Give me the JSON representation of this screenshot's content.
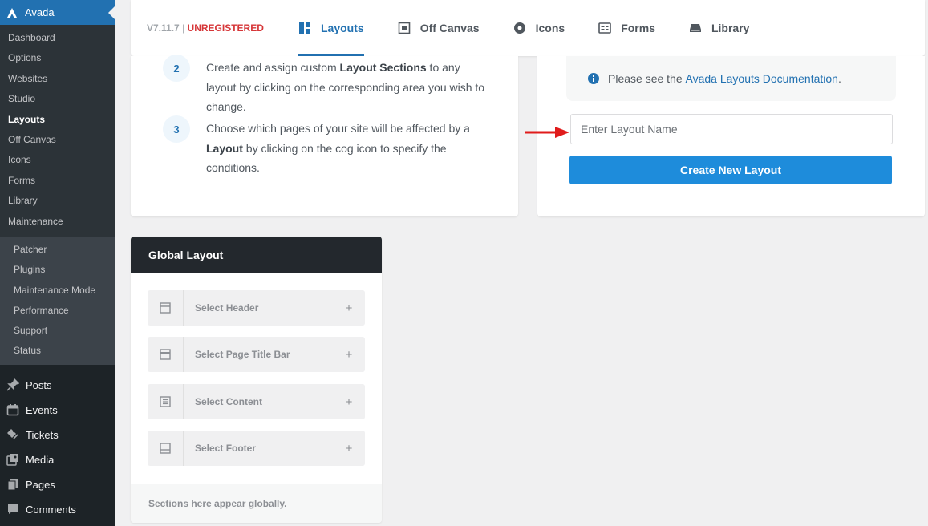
{
  "sidebar": {
    "brand": "Avada",
    "avada_submenu": [
      "Dashboard",
      "Options",
      "Websites",
      "Studio",
      "Layouts",
      "Off Canvas",
      "Icons",
      "Forms",
      "Library",
      "Maintenance"
    ],
    "maintenance_submenu": [
      "Patcher",
      "Plugins",
      "Maintenance Mode",
      "Performance",
      "Support",
      "Status"
    ],
    "main_menu": [
      {
        "label": "Posts",
        "icon": "pin-icon"
      },
      {
        "label": "Events",
        "icon": "calendar-icon"
      },
      {
        "label": "Tickets",
        "icon": "ticket-icon"
      },
      {
        "label": "Media",
        "icon": "media-icon"
      },
      {
        "label": "Pages",
        "icon": "pages-icon"
      },
      {
        "label": "Comments",
        "icon": "comment-icon"
      }
    ]
  },
  "header": {
    "version": "V7.11.7",
    "separator": "|",
    "status": "UNREGISTERED",
    "tabs": [
      {
        "label": "Layouts",
        "icon": "layouts-icon",
        "active": true
      },
      {
        "label": "Off Canvas",
        "icon": "off-canvas-icon",
        "active": false
      },
      {
        "label": "Icons",
        "icon": "icons-icon",
        "active": false
      },
      {
        "label": "Forms",
        "icon": "forms-icon",
        "active": false
      },
      {
        "label": "Library",
        "icon": "library-icon",
        "active": false
      }
    ]
  },
  "steps": [
    {
      "num": "2",
      "pre": "Create and assign custom ",
      "bold": "Layout Sections",
      "post": " to any layout by clicking on the corresponding area you wish to change."
    },
    {
      "num": "3",
      "pre": "Choose which pages of your site will be affected by a ",
      "bold": "Layout",
      "post": " by clicking on the cog icon to specify the conditions."
    }
  ],
  "create": {
    "notice_text": "Please see the ",
    "notice_link": "Avada Layouts Documentation",
    "notice_end": ".",
    "input_placeholder": "Enter Layout Name",
    "input_value": "",
    "button_label": "Create New Layout"
  },
  "global_layout": {
    "title": "Global Layout",
    "sections": [
      {
        "label": "Select Header",
        "icon": "header-icon"
      },
      {
        "label": "Select Page Title Bar",
        "icon": "page-title-bar-icon"
      },
      {
        "label": "Select Content",
        "icon": "content-icon"
      },
      {
        "label": "Select Footer",
        "icon": "footer-icon"
      }
    ],
    "plus": "+",
    "footer_text": "Sections here appear globally."
  },
  "colors": {
    "accent": "#2271b1",
    "button": "#1e8cdb",
    "unregistered": "#d63638",
    "sidebar_bg": "#1d2327",
    "arrow": "#e01b1b"
  }
}
